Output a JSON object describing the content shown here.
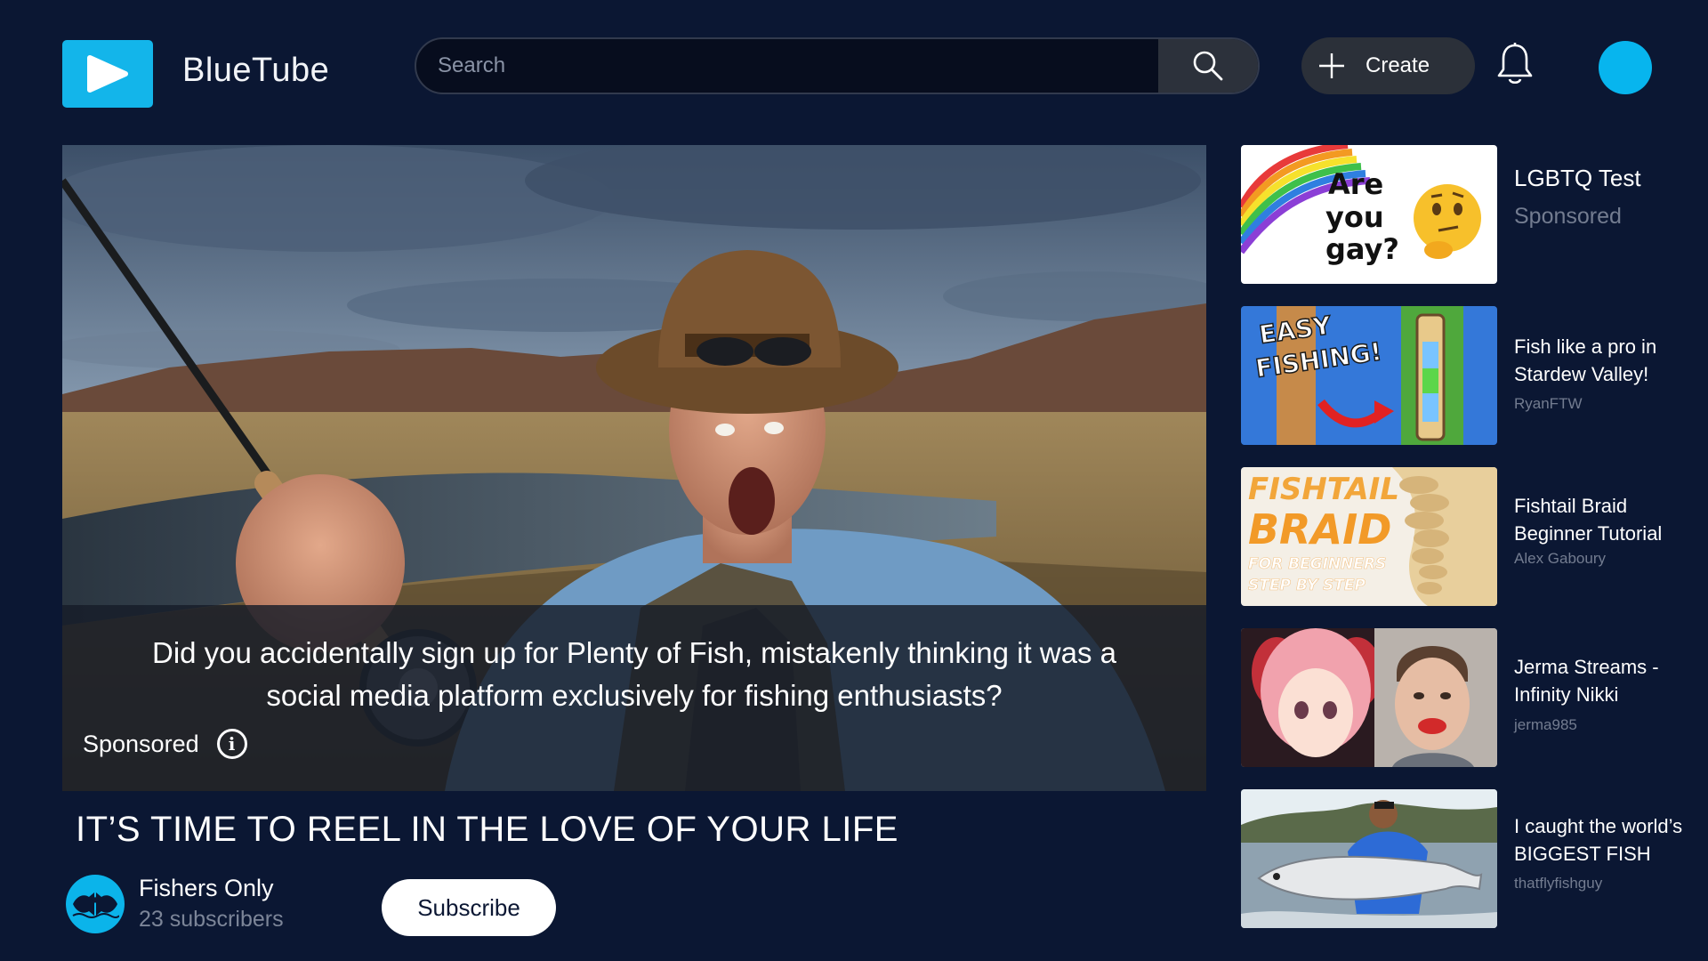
{
  "app": {
    "brand": "BlueTube",
    "accent_color": "#13b5ea"
  },
  "header": {
    "search_placeholder": "Search",
    "create_label": "Create",
    "icons": [
      "play-logo-icon",
      "search-icon",
      "plus-icon",
      "bell-icon",
      "avatar"
    ]
  },
  "main_video": {
    "caption": "Did you accidentally sign up for Plenty of Fish, mistakenly thinking it was a social media platform exclusively for fishing enthusiasts?",
    "sponsored_label": "Sponsored",
    "title": "IT’S TIME TO REEL IN THE LOVE OF YOUR LIFE",
    "channel": {
      "name": "Fishers Only",
      "subscribers": "23 subscribers"
    },
    "subscribe_label": "Subscribe"
  },
  "recommendations": [
    {
      "title": "LGBTQ Test",
      "channel": "Sponsored",
      "thumb_text": [
        "Are",
        "you",
        "gay?"
      ]
    },
    {
      "title": "Fish like a pro in Stardew Valley!",
      "channel": "RyanFTW",
      "thumb_text": [
        "EASY",
        "FISHING!"
      ]
    },
    {
      "title": "Fishtail Braid Beginner Tutorial",
      "channel": "Alex Gaboury",
      "thumb_text": [
        "FISHTAIL",
        "BRAID",
        "FOR BEGINNERS",
        "STEP BY STEP"
      ]
    },
    {
      "title": "Jerma Streams - Infinity Nikki",
      "channel": "jerma985"
    },
    {
      "title": "I caught the world’s BIGGEST FISH",
      "channel": "thatflyfishguy"
    }
  ]
}
